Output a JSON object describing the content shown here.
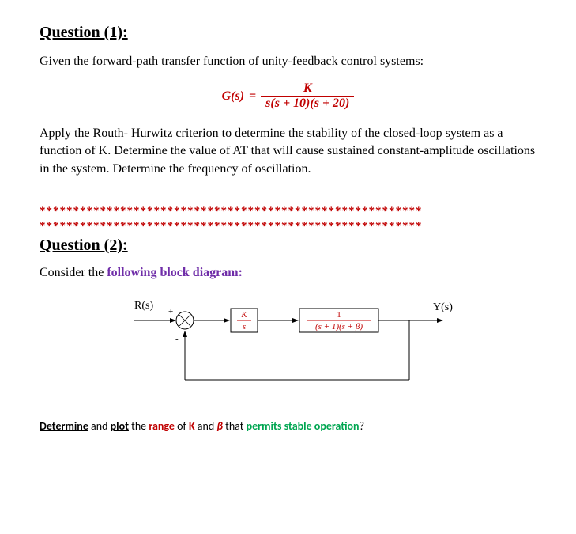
{
  "q1": {
    "heading": "Question (1):",
    "intro": "Given the forward-path transfer function of unity-feedback control systems:",
    "eq_lhs": "G(s)",
    "eq_eq": "=",
    "eq_num": "K",
    "eq_den": "s(s + 10)(s + 20)",
    "body": "Apply the Routh- Hurwitz criterion to determine the stability of the closed-loop system as a function of K. Determine the value of AT that will cause sustained constant-amplitude oscillations in the system. Determine the frequency of oscillation."
  },
  "sep_row": "*********************************************************",
  "q2": {
    "heading": "Question (2):",
    "lead_plain": "Consider the ",
    "lead_purple": "following block diagram:",
    "final": {
      "det": "Determine",
      "and": " and ",
      "plot": "plot",
      "the": " the ",
      "range": "range",
      "of": " of ",
      "k": "K",
      "and2": " and ",
      "beta": "β",
      "that": " that ",
      "permits": "permits stable operation",
      "qm": "?"
    }
  },
  "diagram": {
    "rs": "R(s)",
    "ys": "Y(s)",
    "plus": "+",
    "minus": "-",
    "block1_num": "K",
    "block1_den": "s",
    "block2_num": "1",
    "block2_den": "(s + 1)(s + β)"
  }
}
